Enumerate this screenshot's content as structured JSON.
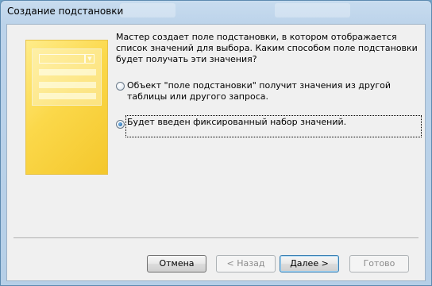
{
  "window": {
    "title": "Создание подстановки"
  },
  "intro_text": "Мастер создает поле подстановки, в котором отображается список значений для выбора. Каким способом поле подстановки будет получать эти значения?",
  "options": [
    {
      "label": "Объект \"поле подстановки\" получит значения из другой таблицы или другого запроса.",
      "selected": false
    },
    {
      "label": "Будет введен фиксированный набор значений.",
      "selected": true
    }
  ],
  "buttons": {
    "cancel": "Отмена",
    "back": "< Назад",
    "next": "Далее >",
    "finish": "Готово"
  }
}
